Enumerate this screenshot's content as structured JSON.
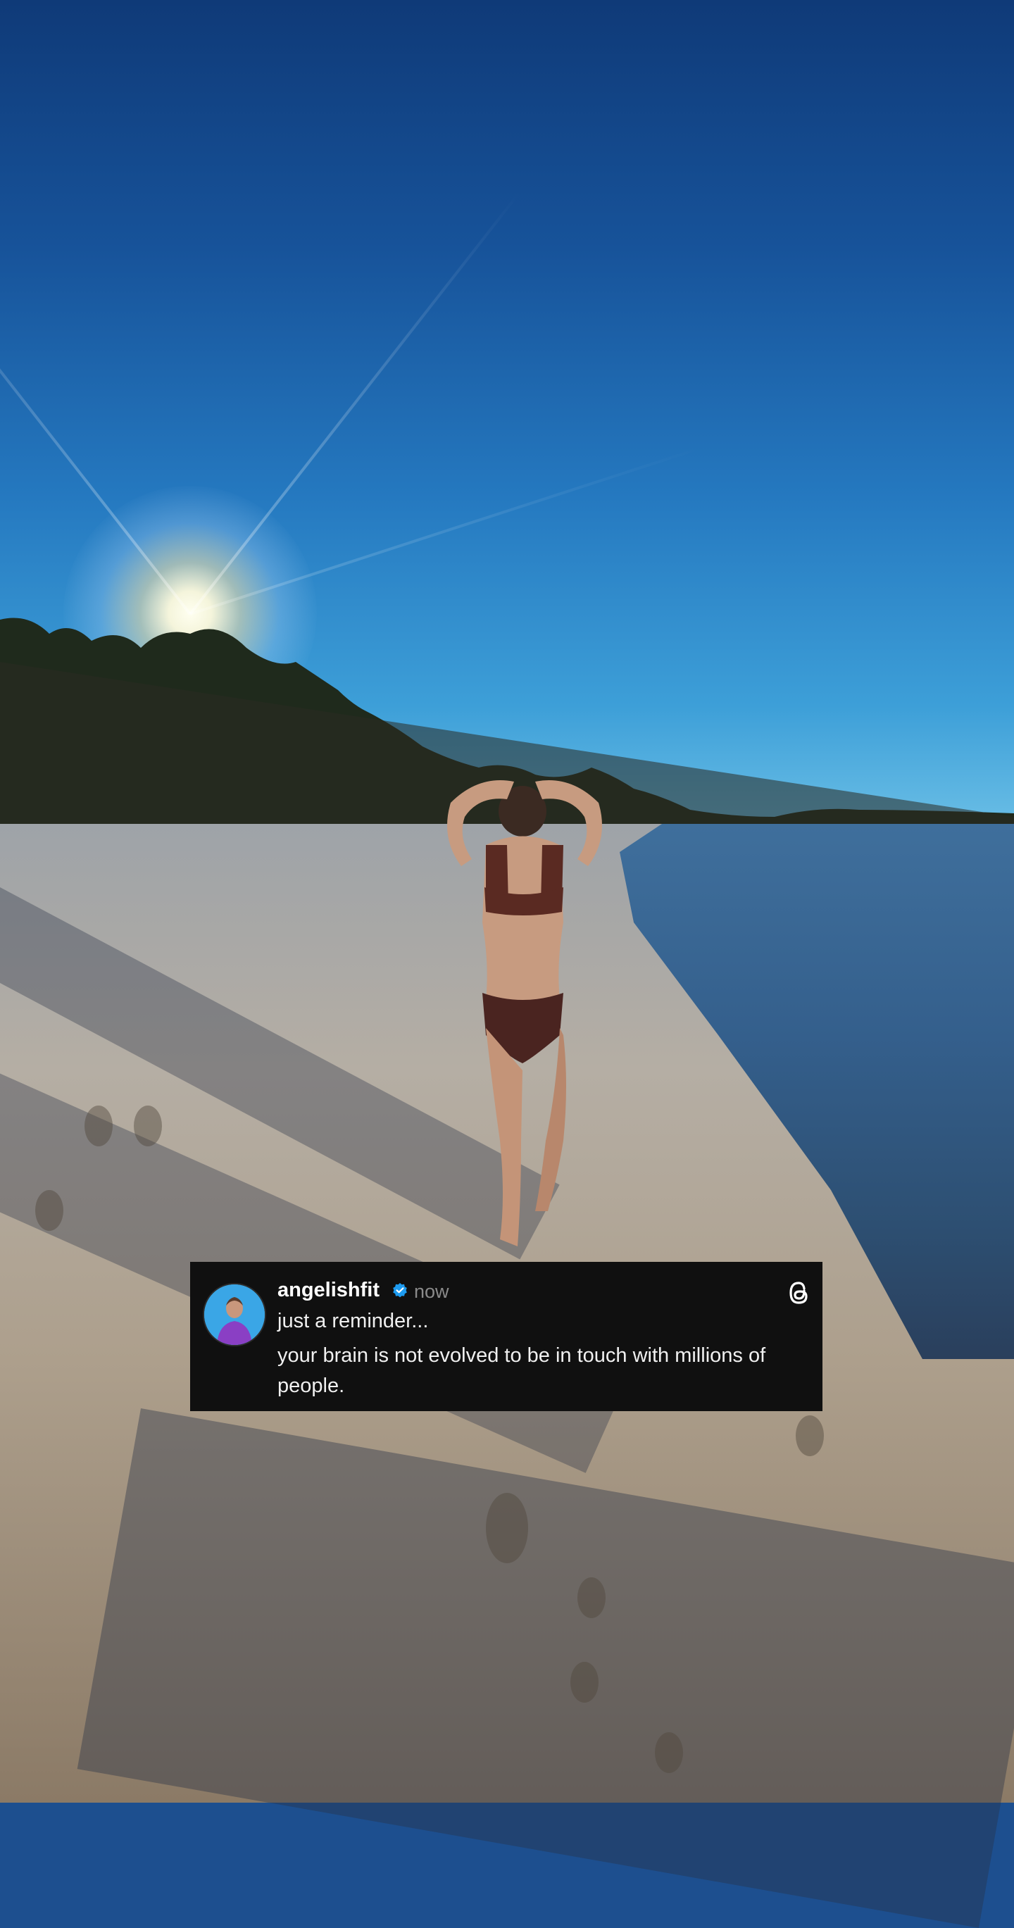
{
  "post": {
    "username": "angelishfit",
    "verified_icon": "verified-badge-icon",
    "timestamp": "now",
    "app_icon": "threads-logo-icon",
    "line1": "just a reminder...",
    "line2": "your brain is not evolved to be in touch with millions of people."
  },
  "colors": {
    "card_background": "#101010",
    "verified_blue": "#1d9bf0",
    "timestamp_gray": "#8a8a8a"
  }
}
